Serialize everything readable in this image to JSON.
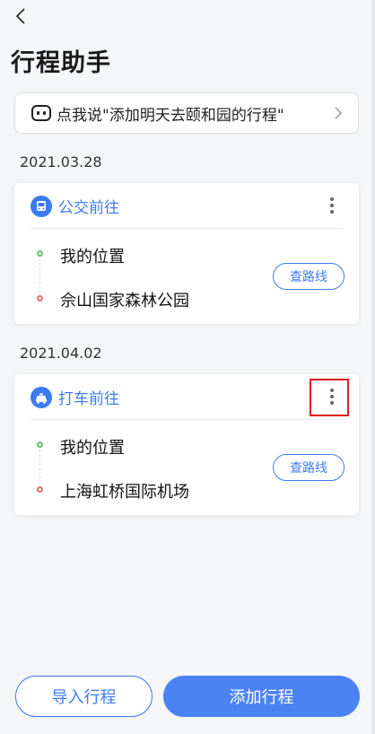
{
  "header": {
    "title": "行程助手"
  },
  "voice_hint": {
    "text": "点我说\"添加明天去颐和园的行程\""
  },
  "trips": [
    {
      "date": "2021.03.28",
      "mode_label": "公交前往",
      "mode_icon": "bus-icon",
      "origin": "我的位置",
      "destination": "佘山国家森林公园",
      "route_label": "查路线"
    },
    {
      "date": "2021.04.02",
      "mode_label": "打车前往",
      "mode_icon": "taxi-icon",
      "origin": "我的位置",
      "destination": "上海虹桥国际机场",
      "route_label": "查路线"
    }
  ],
  "actions": {
    "import_label": "导入行程",
    "add_label": "添加行程"
  },
  "colors": {
    "accent": "#3b7bf5",
    "highlight": "#e02020",
    "origin_dot": "#6cc36a",
    "destination_dot": "#e86b6b"
  }
}
